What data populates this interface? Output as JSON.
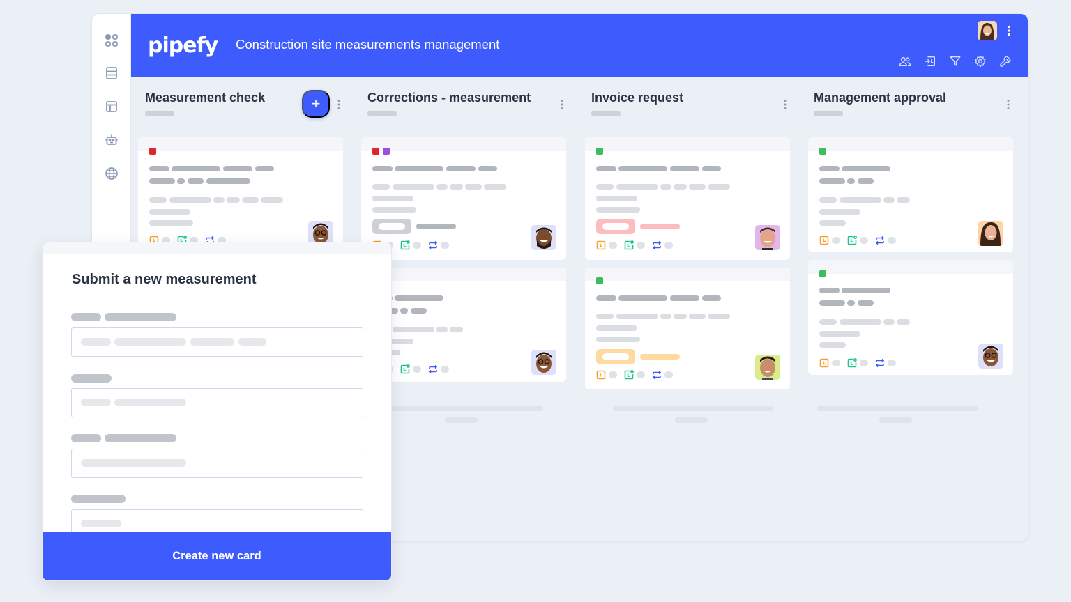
{
  "app": {
    "logo": "pipefy",
    "pipe_title": "Construction site measurements management",
    "brand_color": "#3e5bfe"
  },
  "sidebar": {
    "items": [
      {
        "icon": "apps-grid-icon"
      },
      {
        "icon": "database-icon"
      },
      {
        "icon": "layout-panel-icon"
      },
      {
        "icon": "robot-icon"
      },
      {
        "icon": "globe-icon"
      }
    ]
  },
  "header_tools": [
    {
      "icon": "members-icon"
    },
    {
      "icon": "import-icon"
    },
    {
      "icon": "filter-icon"
    },
    {
      "icon": "settings-gear-icon"
    },
    {
      "icon": "wrench-icon"
    }
  ],
  "phases": [
    {
      "title": "Measurement check",
      "add_label": "+"
    },
    {
      "title": "Corrections - measurement"
    },
    {
      "title": "Invoice request"
    },
    {
      "title": "Management approval"
    }
  ],
  "card_label_colors": {
    "red": "#e0252c",
    "purple": "#9d4ddf",
    "green": "#3dbd5b"
  },
  "card_tags": {
    "gray": "#cdd1d6",
    "pink": "#fdbcbf",
    "orange": "#fedaa1"
  },
  "card_icon_colors": {
    "due-date": "#fb9c2a",
    "created": "#19c58e",
    "repeat": "#3e5bfe"
  },
  "modal": {
    "title": "Submit a new measurement",
    "submit_label": "Create new card"
  }
}
